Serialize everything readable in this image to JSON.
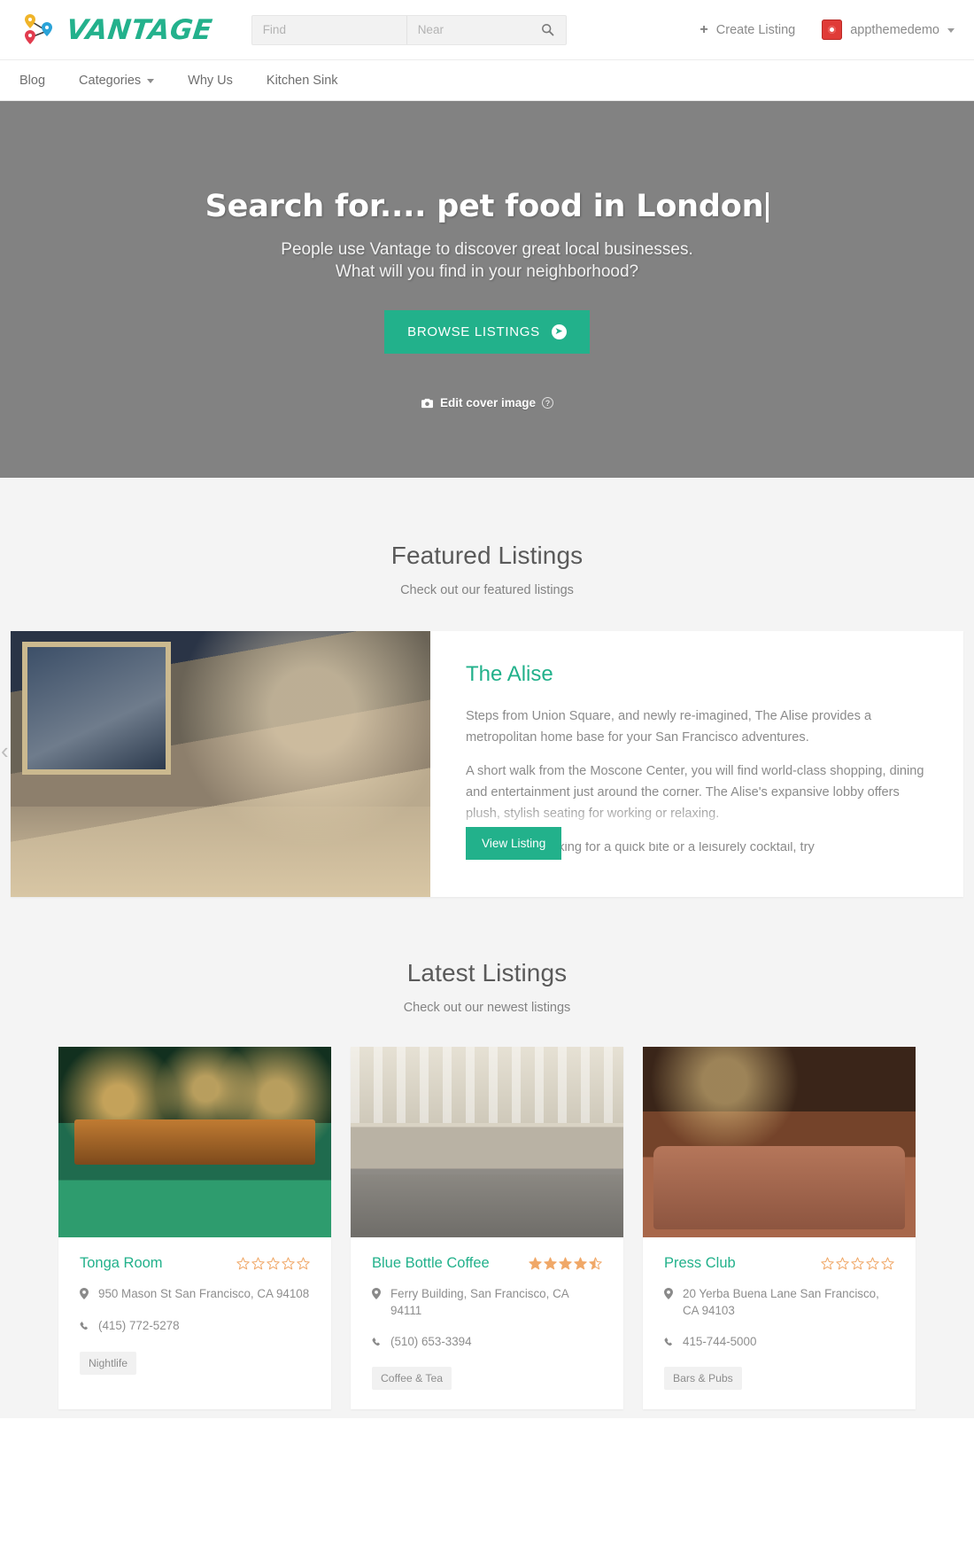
{
  "brand": {
    "name": "VANTAGE",
    "logo_icon": "map-pins-logo",
    "accent": "#22b18b"
  },
  "search": {
    "find_placeholder": "Find",
    "near_placeholder": "Near",
    "find_value": "",
    "near_value": "",
    "search_icon": "search-icon"
  },
  "topbar": {
    "create_listing_label": "Create Listing",
    "create_listing_icon": "plus-icon",
    "username": "appthemedemo",
    "avatar_icon": "user-avatar",
    "caret_icon": "chevron-down-icon"
  },
  "nav": {
    "items": [
      {
        "label": "Blog",
        "has_caret": false
      },
      {
        "label": "Categories",
        "has_caret": true
      },
      {
        "label": "Why Us",
        "has_caret": false
      },
      {
        "label": "Kitchen Sink",
        "has_caret": false
      }
    ]
  },
  "hero": {
    "title": "Search for.... pet food in London",
    "subtitle_line1": "People use Vantage to discover great local businesses.",
    "subtitle_line2": "What will you find in your neighborhood?",
    "cta_label": "BROWSE LISTINGS",
    "cta_icon": "arrow-right-circle-icon",
    "edit_cover_label": "Edit cover image",
    "edit_cover_icon": "camera-icon",
    "help_icon": "question-mark-icon",
    "help_label": "?"
  },
  "featured": {
    "title": "Featured Listings",
    "subtitle": "Check out our featured listings",
    "prev_arrow": "‹",
    "next_arrow": "›",
    "listing": {
      "name": "The Alise",
      "photo": "alise-lobby-photo",
      "paragraph1": "Steps from Union Square, and newly re-imagined, The Alise provides a metropolitan home base for your San Francisco adventures.",
      "paragraph2": "A short walk from the Moscone Center, you will find world-class shopping, dining and entertainment just around the corner. The Alise's expansive lobby offers plush, stylish seating for working or relaxing.",
      "paragraph3_faded": "And if you're looking for a quick bite or a leisurely cocktail, try",
      "button_label": "View Listing"
    }
  },
  "latest": {
    "title": "Latest Listings",
    "subtitle": "Check out our newest listings",
    "location_icon": "map-pin-icon",
    "phone_icon": "phone-icon",
    "cards": [
      {
        "name": "Tonga Room",
        "photo": "tonga-room-photo",
        "rating": 0,
        "address": "950 Mason St San Francisco, CA 94108",
        "phone": "(415) 772-5278",
        "tag": "Nightlife"
      },
      {
        "name": "Blue Bottle Coffee",
        "photo": "blue-bottle-photo",
        "rating": 4.5,
        "address": "Ferry Building, San Francisco, CA 94111",
        "phone": "(510) 653-3394",
        "tag": "Coffee & Tea"
      },
      {
        "name": "Press Club",
        "photo": "press-club-photo",
        "rating": 0,
        "address": "20 Yerba Buena Lane San Francisco, CA 94103",
        "phone": "415-744-5000",
        "tag": "Bars & Pubs"
      }
    ]
  }
}
